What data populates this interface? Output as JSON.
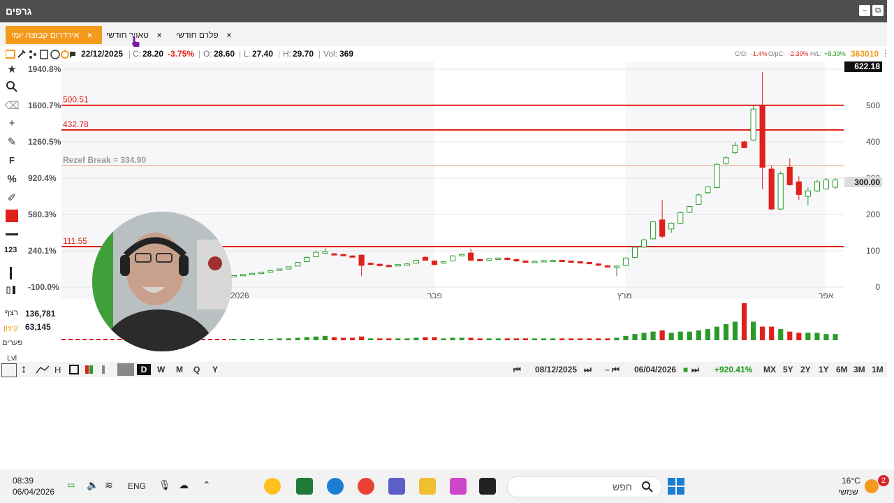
{
  "window": {
    "title": "גרפים",
    "minimize": "–",
    "restore": "⧉"
  },
  "tabs": [
    {
      "label": "אירדרום קבוצה יומי",
      "active": true,
      "close": "×"
    },
    {
      "label": "טאוור חודשי",
      "active": false,
      "close": "×"
    },
    {
      "label": "פלרם חודשי",
      "active": false,
      "close": "×"
    }
  ],
  "info": {
    "date": "22/12/2025",
    "c_label": "C:",
    "c_value": "28.20",
    "c_change": "-3.75%",
    "o_label": "O:",
    "o_value": "28.60",
    "l_label": "L:",
    "l_value": "27.40",
    "h_label": "H:",
    "h_value": "29.70",
    "vol_label": "Vol:",
    "vol_value": "369",
    "co_label": "C/O:",
    "co_value": "-1.4%",
    "opc_label": "O/pC:",
    "opc_value": "-2.39%",
    "hl_label": "H/L:",
    "hl_value": "+8.39%",
    "code": "363010"
  },
  "left_axis": {
    "ticks": [
      "1940.8%",
      "1600.7%",
      "1260.5%",
      "920.4%",
      "580.3%",
      "240.1%",
      "-100.0%"
    ],
    "volume_ticks": [
      "136,781",
      "63,145"
    ]
  },
  "right_axis": {
    "ticks": [
      "500",
      "400",
      "300",
      "200",
      "100",
      "0"
    ],
    "top_value": "622.18",
    "current_value": "300.00"
  },
  "levels": [
    {
      "label": "500.51",
      "value": 500.51,
      "color": "#e0201a"
    },
    {
      "label": "432.78",
      "value": 432.78,
      "color": "#e0201a"
    },
    {
      "label": "111.55",
      "value": 111.55,
      "color": "#e0201a"
    },
    {
      "label": "Rezef Break = 334.90",
      "value": 334.9,
      "color": "#e3a678"
    }
  ],
  "x_axis": {
    "ticks": [
      "2026",
      "פבר",
      "מרץ",
      "אפר"
    ]
  },
  "left_labels": {
    "rezef": "רצף",
    "kitzon": "קיצון",
    "pearim": "פערים",
    "lvl": "Lvl"
  },
  "bottom": {
    "periods": [
      "D",
      "W",
      "M",
      "Q",
      "Y"
    ],
    "active_period": "D",
    "start_date": "08/12/2025",
    "dash": "–",
    "end_date": "06/04/2026",
    "change": "+920.41%",
    "ranges": [
      "MX",
      "5Y",
      "2Y",
      "1Y",
      "6M",
      "3M",
      "1M"
    ]
  },
  "taskbar": {
    "time": "08:39",
    "date": "06/04/2026",
    "lang": "ENG",
    "search_placeholder": "חפש",
    "weather_temp": "16°C",
    "weather_text": "שמשי",
    "notification_count": "2"
  },
  "colors": {
    "up": "#2a9a2a",
    "down": "#e0201a",
    "accent": "#f49a1c",
    "level": "#e0201a"
  },
  "chart_data": {
    "type": "candlestick",
    "right_axis_range": [
      0,
      600
    ],
    "left_axis_range_percent": [
      -100.0,
      1940.8
    ],
    "x_range": [
      "2025-12-08",
      "2026-04-06"
    ],
    "levels": [
      500.51,
      432.78,
      334.9,
      111.55
    ],
    "candles": [
      {
        "o": 32,
        "c": 32,
        "h": 34,
        "l": 30
      },
      {
        "o": 34,
        "c": 35,
        "h": 36,
        "l": 33
      },
      {
        "o": 36,
        "c": 38,
        "h": 39,
        "l": 35
      },
      {
        "o": 39,
        "c": 41,
        "h": 43,
        "l": 38
      },
      {
        "o": 42,
        "c": 45,
        "h": 47,
        "l": 41
      },
      {
        "o": 46,
        "c": 50,
        "h": 51,
        "l": 45
      },
      {
        "o": 50,
        "c": 56,
        "h": 57,
        "l": 49
      },
      {
        "o": 58,
        "c": 68,
        "h": 70,
        "l": 57
      },
      {
        "o": 70,
        "c": 82,
        "h": 84,
        "l": 69
      },
      {
        "o": 84,
        "c": 96,
        "h": 100,
        "l": 83
      },
      {
        "o": 95,
        "c": 97,
        "h": 107,
        "l": 92
      },
      {
        "o": 92,
        "c": 90,
        "h": 94,
        "l": 88
      },
      {
        "o": 90,
        "c": 87,
        "h": 91,
        "l": 85
      },
      {
        "o": 86,
        "c": 84,
        "h": 87,
        "l": 82
      },
      {
        "o": 88,
        "c": 60,
        "h": 90,
        "l": 30
      },
      {
        "o": 66,
        "c": 64,
        "h": 68,
        "l": 62
      },
      {
        "o": 63,
        "c": 59,
        "h": 65,
        "l": 57
      },
      {
        "o": 60,
        "c": 58,
        "h": 62,
        "l": 56
      },
      {
        "o": 60,
        "c": 62,
        "h": 64,
        "l": 59
      },
      {
        "o": 62,
        "c": 64,
        "h": 66,
        "l": 61
      },
      {
        "o": 66,
        "c": 74,
        "h": 76,
        "l": 65
      },
      {
        "o": 82,
        "c": 74,
        "h": 86,
        "l": 73
      },
      {
        "o": 72,
        "c": 62,
        "h": 74,
        "l": 60
      },
      {
        "o": 66,
        "c": 70,
        "h": 72,
        "l": 64
      },
      {
        "o": 72,
        "c": 86,
        "h": 88,
        "l": 71
      },
      {
        "o": 87,
        "c": 90,
        "h": 92,
        "l": 86
      },
      {
        "o": 94,
        "c": 74,
        "h": 106,
        "l": 72
      },
      {
        "o": 76,
        "c": 74,
        "h": 78,
        "l": 72
      },
      {
        "o": 74,
        "c": 78,
        "h": 80,
        "l": 72
      },
      {
        "o": 78,
        "c": 80,
        "h": 82,
        "l": 77
      },
      {
        "o": 80,
        "c": 76,
        "h": 82,
        "l": 74
      },
      {
        "o": 76,
        "c": 72,
        "h": 78,
        "l": 70
      },
      {
        "o": 72,
        "c": 70,
        "h": 74,
        "l": 68
      },
      {
        "o": 70,
        "c": 71,
        "h": 73,
        "l": 69
      },
      {
        "o": 71,
        "c": 73,
        "h": 75,
        "l": 70
      },
      {
        "o": 73,
        "c": 74,
        "h": 76,
        "l": 72
      },
      {
        "o": 74,
        "c": 72,
        "h": 76,
        "l": 71
      },
      {
        "o": 72,
        "c": 70,
        "h": 73,
        "l": 69
      },
      {
        "o": 70,
        "c": 68,
        "h": 72,
        "l": 67
      },
      {
        "o": 68,
        "c": 65,
        "h": 70,
        "l": 64
      },
      {
        "o": 64,
        "c": 60,
        "h": 66,
        "l": 58
      },
      {
        "o": 59,
        "c": 56,
        "h": 61,
        "l": 54
      },
      {
        "o": 55,
        "c": 58,
        "h": 60,
        "l": 30
      },
      {
        "o": 60,
        "c": 80,
        "h": 82,
        "l": 58
      },
      {
        "o": 82,
        "c": 110,
        "h": 112,
        "l": 80
      },
      {
        "o": 110,
        "c": 130,
        "h": 133,
        "l": 108
      },
      {
        "o": 133,
        "c": 180,
        "h": 182,
        "l": 131
      },
      {
        "o": 185,
        "c": 140,
        "h": 240,
        "l": 135
      },
      {
        "o": 160,
        "c": 176,
        "h": 178,
        "l": 150
      },
      {
        "o": 176,
        "c": 205,
        "h": 208,
        "l": 174
      },
      {
        "o": 206,
        "c": 222,
        "h": 224,
        "l": 204
      },
      {
        "o": 228,
        "c": 254,
        "h": 258,
        "l": 226
      },
      {
        "o": 260,
        "c": 276,
        "h": 278,
        "l": 256
      },
      {
        "o": 274,
        "c": 338,
        "h": 342,
        "l": 272
      },
      {
        "o": 340,
        "c": 356,
        "h": 362,
        "l": 336
      },
      {
        "o": 370,
        "c": 390,
        "h": 400,
        "l": 366
      },
      {
        "o": 400,
        "c": 384,
        "h": 403,
        "l": 382
      },
      {
        "o": 405,
        "c": 490,
        "h": 500,
        "l": 402
      },
      {
        "o": 500,
        "c": 330,
        "h": 592,
        "l": 270
      },
      {
        "o": 325,
        "c": 215,
        "h": 335,
        "l": 212
      },
      {
        "o": 215,
        "c": 312,
        "h": 318,
        "l": 212
      },
      {
        "o": 330,
        "c": 282,
        "h": 355,
        "l": 279
      },
      {
        "o": 290,
        "c": 255,
        "h": 305,
        "l": 240
      },
      {
        "o": 250,
        "c": 265,
        "h": 275,
        "l": 225
      },
      {
        "o": 265,
        "c": 290,
        "h": 295,
        "l": 262
      },
      {
        "o": 270,
        "c": 295,
        "h": 300,
        "l": 268
      },
      {
        "o": 275,
        "c": 295,
        "h": 300,
        "l": 270
      }
    ],
    "volume_up": [
      true,
      true,
      true,
      true,
      true,
      true,
      true,
      true,
      true,
      true,
      true,
      false,
      false,
      false,
      false,
      true,
      false,
      false,
      true,
      true,
      true,
      false,
      false,
      true,
      true,
      true,
      false,
      false,
      true,
      true,
      false,
      false,
      false,
      true,
      true,
      true,
      false,
      false,
      false,
      false,
      false,
      false,
      true,
      true,
      true,
      true,
      true,
      false,
      true,
      true,
      true,
      true,
      true,
      true,
      true,
      true,
      false,
      true,
      false,
      false,
      true,
      false,
      false,
      true,
      true,
      true,
      true
    ],
    "volume": [
      2,
      2,
      2,
      2,
      2,
      3,
      3,
      4,
      5,
      6,
      7,
      5,
      4,
      4,
      6,
      3,
      3,
      3,
      3,
      3,
      4,
      5,
      5,
      3,
      4,
      4,
      4,
      3,
      3,
      3,
      3,
      3,
      3,
      3,
      3,
      3,
      3,
      3,
      3,
      3,
      3,
      3,
      4,
      7,
      10,
      12,
      14,
      16,
      12,
      14,
      14,
      16,
      18,
      22,
      26,
      30,
      60,
      30,
      22,
      22,
      18,
      14,
      12,
      12,
      12,
      10,
      10
    ],
    "volume_range_max": 136781
  }
}
